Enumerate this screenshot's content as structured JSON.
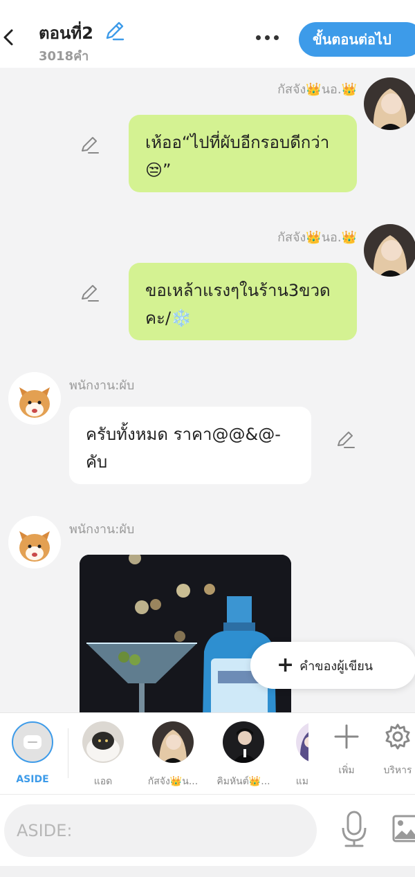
{
  "header": {
    "back_icon": "chevron-left-icon",
    "title": "ตอนที่2",
    "title_edit_icon": "pencil-icon",
    "word_count": "3018คำ",
    "more_icon": "more-dots-icon",
    "next_button": "ขั้นตอนต่อไป"
  },
  "messages": [
    {
      "sender": "กัสจัง👑นอ.👑",
      "text": "เห้ออ“ไปที่ผับอีกรอบดีกว่า😒”",
      "side": "right"
    },
    {
      "sender": "กัสจัง👑นอ.👑",
      "text": "ขอเหล้าแรงๆในร้าน3ขวดคะ/❄️",
      "side": "right"
    },
    {
      "sender": "พนักงาน:ผับ",
      "text": "ครับทั้งหมด ราคา@@&@- คับ",
      "side": "left"
    },
    {
      "sender": "พนักงาน:ผับ",
      "text": "",
      "side": "left",
      "image": "martini-and-gin-bottle-photo"
    }
  ],
  "author_button": "คำของผู้เขียน",
  "characters": [
    {
      "label": "ASIDE",
      "icon": "aside-bubble-icon"
    },
    {
      "label": "แอด"
    },
    {
      "label": "กัสจัง👑น..."
    },
    {
      "label": "คิมหันต์👑..."
    },
    {
      "label": "แม"
    }
  ],
  "actions": {
    "add": {
      "label": "เพิ่ม",
      "icon": "plus-icon"
    },
    "manage": {
      "label": "บริหาร",
      "icon": "gear-icon"
    }
  },
  "input": {
    "placeholder": "ASIDE:",
    "mic_icon": "microphone-icon",
    "gallery_icon": "image-gallery-icon"
  },
  "colors": {
    "accent": "#3d9be9",
    "right_bubble": "#d4f292",
    "left_bubble": "#ffffff",
    "background": "#f3f3f4"
  }
}
